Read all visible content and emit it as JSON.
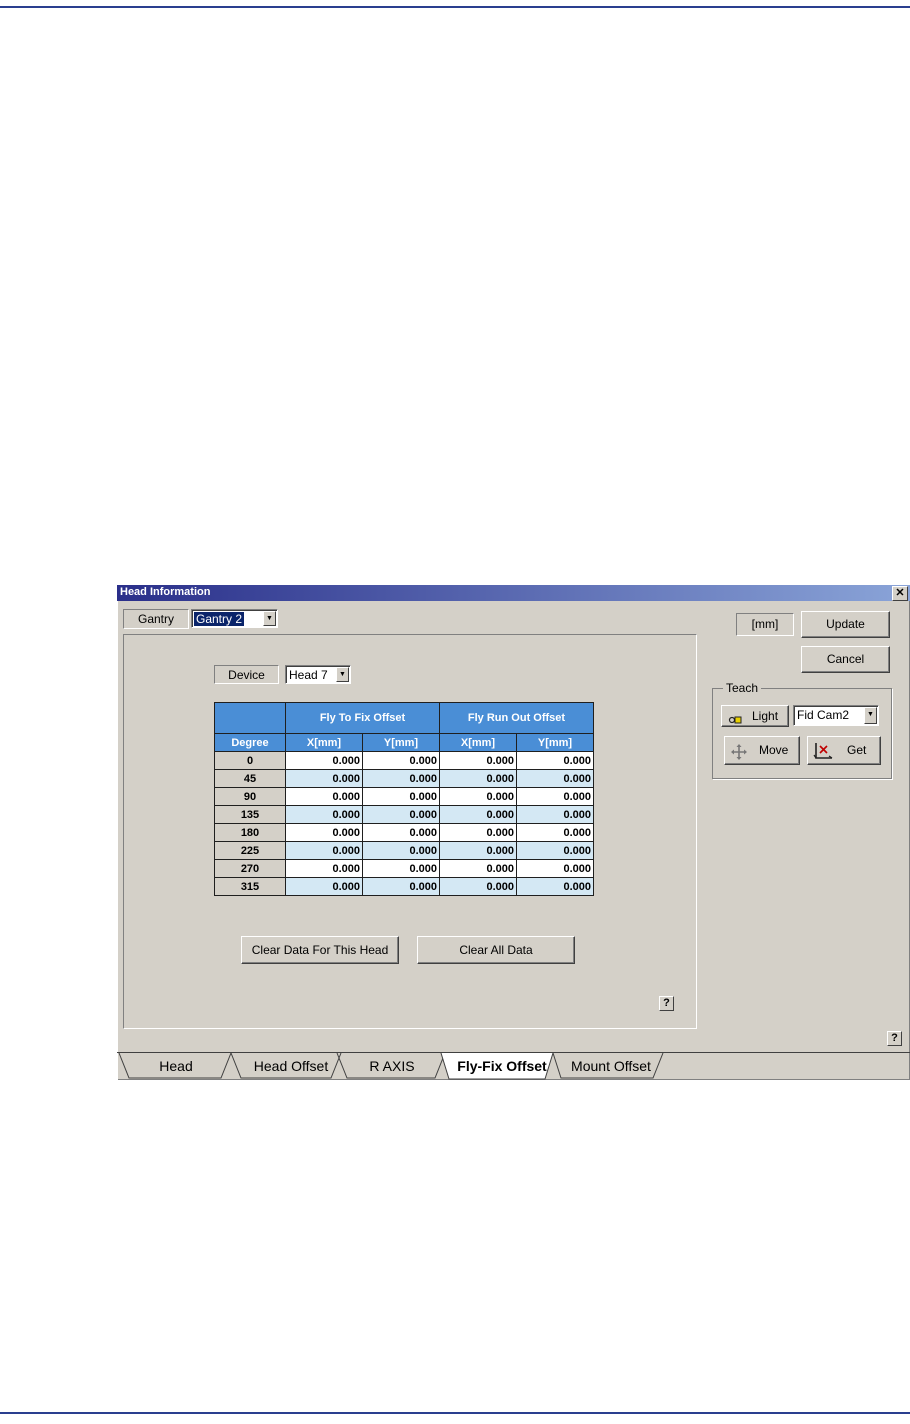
{
  "window": {
    "title": "Head Information",
    "close": "✕"
  },
  "gantry": {
    "label": "Gantry",
    "value": "Gantry 2"
  },
  "device": {
    "label": "Device",
    "value": "Head 7"
  },
  "unit": "[mm]",
  "buttons": {
    "update": "Update",
    "cancel": "Cancel",
    "clear_head": "Clear Data For This Head",
    "clear_all": "Clear All Data"
  },
  "teach": {
    "label": "Teach",
    "light": "Light",
    "camera": "Fid Cam2",
    "move": "Move",
    "get": "Get"
  },
  "table": {
    "group_headers": [
      "Fly To Fix Offset",
      "Fly Run Out Offset"
    ],
    "columns": [
      "Degree",
      "X[mm]",
      "Y[mm]",
      "X[mm]",
      "Y[mm]"
    ],
    "rows": [
      [
        "0",
        "0.000",
        "0.000",
        "0.000",
        "0.000"
      ],
      [
        "45",
        "0.000",
        "0.000",
        "0.000",
        "0.000"
      ],
      [
        "90",
        "0.000",
        "0.000",
        "0.000",
        "0.000"
      ],
      [
        "135",
        "0.000",
        "0.000",
        "0.000",
        "0.000"
      ],
      [
        "180",
        "0.000",
        "0.000",
        "0.000",
        "0.000"
      ],
      [
        "225",
        "0.000",
        "0.000",
        "0.000",
        "0.000"
      ],
      [
        "270",
        "0.000",
        "0.000",
        "0.000",
        "0.000"
      ],
      [
        "315",
        "0.000",
        "0.000",
        "0.000",
        "0.000"
      ]
    ]
  },
  "help": "?",
  "tabs": [
    "Head",
    "Head Offset",
    "R AXIS",
    "Fly-Fix Offset",
    "Mount Offset"
  ],
  "active_tab": "Fly-Fix Offset",
  "colors": {
    "header_blue": "#4a8ed6",
    "row_alt": "#d4e8f4",
    "title_blue": "#2a2f8a"
  }
}
